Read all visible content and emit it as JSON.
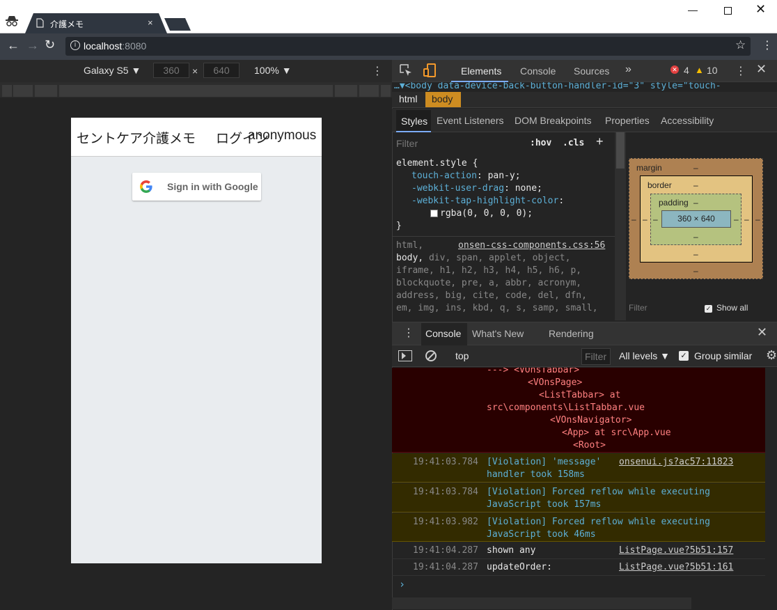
{
  "browser": {
    "tab_title": "介護メモ",
    "tab_close": "×",
    "url_host": "localhost",
    "url_port": ":8080",
    "star": "☆",
    "menu": "⋮",
    "win_min": "—",
    "win_close": "✕"
  },
  "device_toolbar": {
    "device": "Galaxy S5 ▼",
    "width": "360",
    "x": "×",
    "height": "640",
    "zoom": "100% ▼",
    "menu": "⋮"
  },
  "app": {
    "title": "セントケア介護メモ",
    "login": "ログイン",
    "user": "anonymous",
    "google_button": "Sign in with Google"
  },
  "devtools": {
    "tabs": [
      "Elements",
      "Console",
      "Sources",
      "»"
    ],
    "errors": "4",
    "warnings": "10",
    "menu": "⋮",
    "close": "✕",
    "dom_line": "…▼<body data-device-back-button-handler-id=\"3\" style=\"touch-",
    "breadcrumbs": [
      "html",
      "body"
    ],
    "subtabs": [
      "Styles",
      "Event Listeners",
      "DOM Breakpoints",
      "Properties",
      "Accessibility"
    ],
    "filter_placeholder": "Filter",
    "hov": ":hov",
    "cls": ".cls",
    "plus": "+",
    "styles": {
      "element_style": "element.style {",
      "rules": [
        {
          "prop": "touch-action",
          "val": "pan-y;"
        },
        {
          "prop": "-webkit-user-drag",
          "val": "none;"
        },
        {
          "prop": "-webkit-tap-highlight-color",
          "val": ""
        }
      ],
      "rgba": "rgba(0, 0, 0, 0);",
      "close_brace": "}",
      "html_sel": "html,",
      "source": "onsen-css-components.css:56",
      "selector_lines": [
        "body, div, span, applet, object,",
        "iframe, h1, h2, h3, h4, h5, h6, p,",
        "blockquote, pre, a, abbr, acronym,",
        "address, big, cite, code, del, dfn,",
        "em, img, ins, kbd, q, s, samp, small,"
      ]
    },
    "box_model": {
      "margin": "margin",
      "border": "border",
      "padding": "padding",
      "content": "360 × 640",
      "dash": "–",
      "filter": "Filter",
      "show_all": "Show all"
    }
  },
  "console": {
    "drawer_tabs": [
      "Console",
      "What's New",
      "Rendering"
    ],
    "context": "top",
    "filter_placeholder": "Filter",
    "levels": "All levels ▼",
    "group_similar": "Group similar",
    "error_lines": [
      "---> <VOnsTabbar>",
      "<VOnsPage>",
      "<ListTabbar> at",
      "src\\components\\ListTabbar.vue",
      "<VOnsNavigator>",
      "<App> at src\\App.vue",
      "<Root>"
    ],
    "violations": [
      {
        "time": "19:41:03.784",
        "line1": "[Violation] 'message'",
        "line2": "handler took 158ms",
        "src": "onsenui.js?ac57:11823"
      },
      {
        "time": "19:41:03.784",
        "line1": "[Violation] Forced reflow while executing",
        "line2": "JavaScript took 157ms",
        "src": ""
      },
      {
        "time": "19:41:03.982",
        "line1": "[Violation] Forced reflow while executing",
        "line2": "JavaScript took 46ms",
        "src": ""
      }
    ],
    "logs": [
      {
        "time": "19:41:04.287",
        "msg": "shown any",
        "src": "ListPage.vue?5b51:157"
      },
      {
        "time": "19:41:04.287",
        "msg": "updateOrder:",
        "src": "ListPage.vue?5b51:161"
      }
    ],
    "prompt": "›"
  },
  "colors": {
    "accent": "#7cacf8",
    "breadcrumb_active": "#cd8c21",
    "error_bg": "#290000",
    "warning_bg": "#332b00"
  }
}
